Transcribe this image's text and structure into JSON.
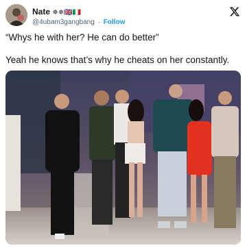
{
  "tweet": {
    "display_name": "Nate",
    "name_emoji": "✵✵🇬🇧🇮🇹",
    "handle": "@4ubam3gangbang",
    "separator": "·",
    "follow_label": "Follow",
    "text_line1": "“Whys he with her? He can do better”",
    "text_line2": "Yeah he knows that’s why he cheats on her constantly.",
    "media_description_icon": "photo",
    "icons": [
      "avatar",
      "x-logo-icon"
    ]
  },
  "colors": {
    "follow": "#1d9bf0",
    "handle": "#536471",
    "text": "#0f1419"
  }
}
